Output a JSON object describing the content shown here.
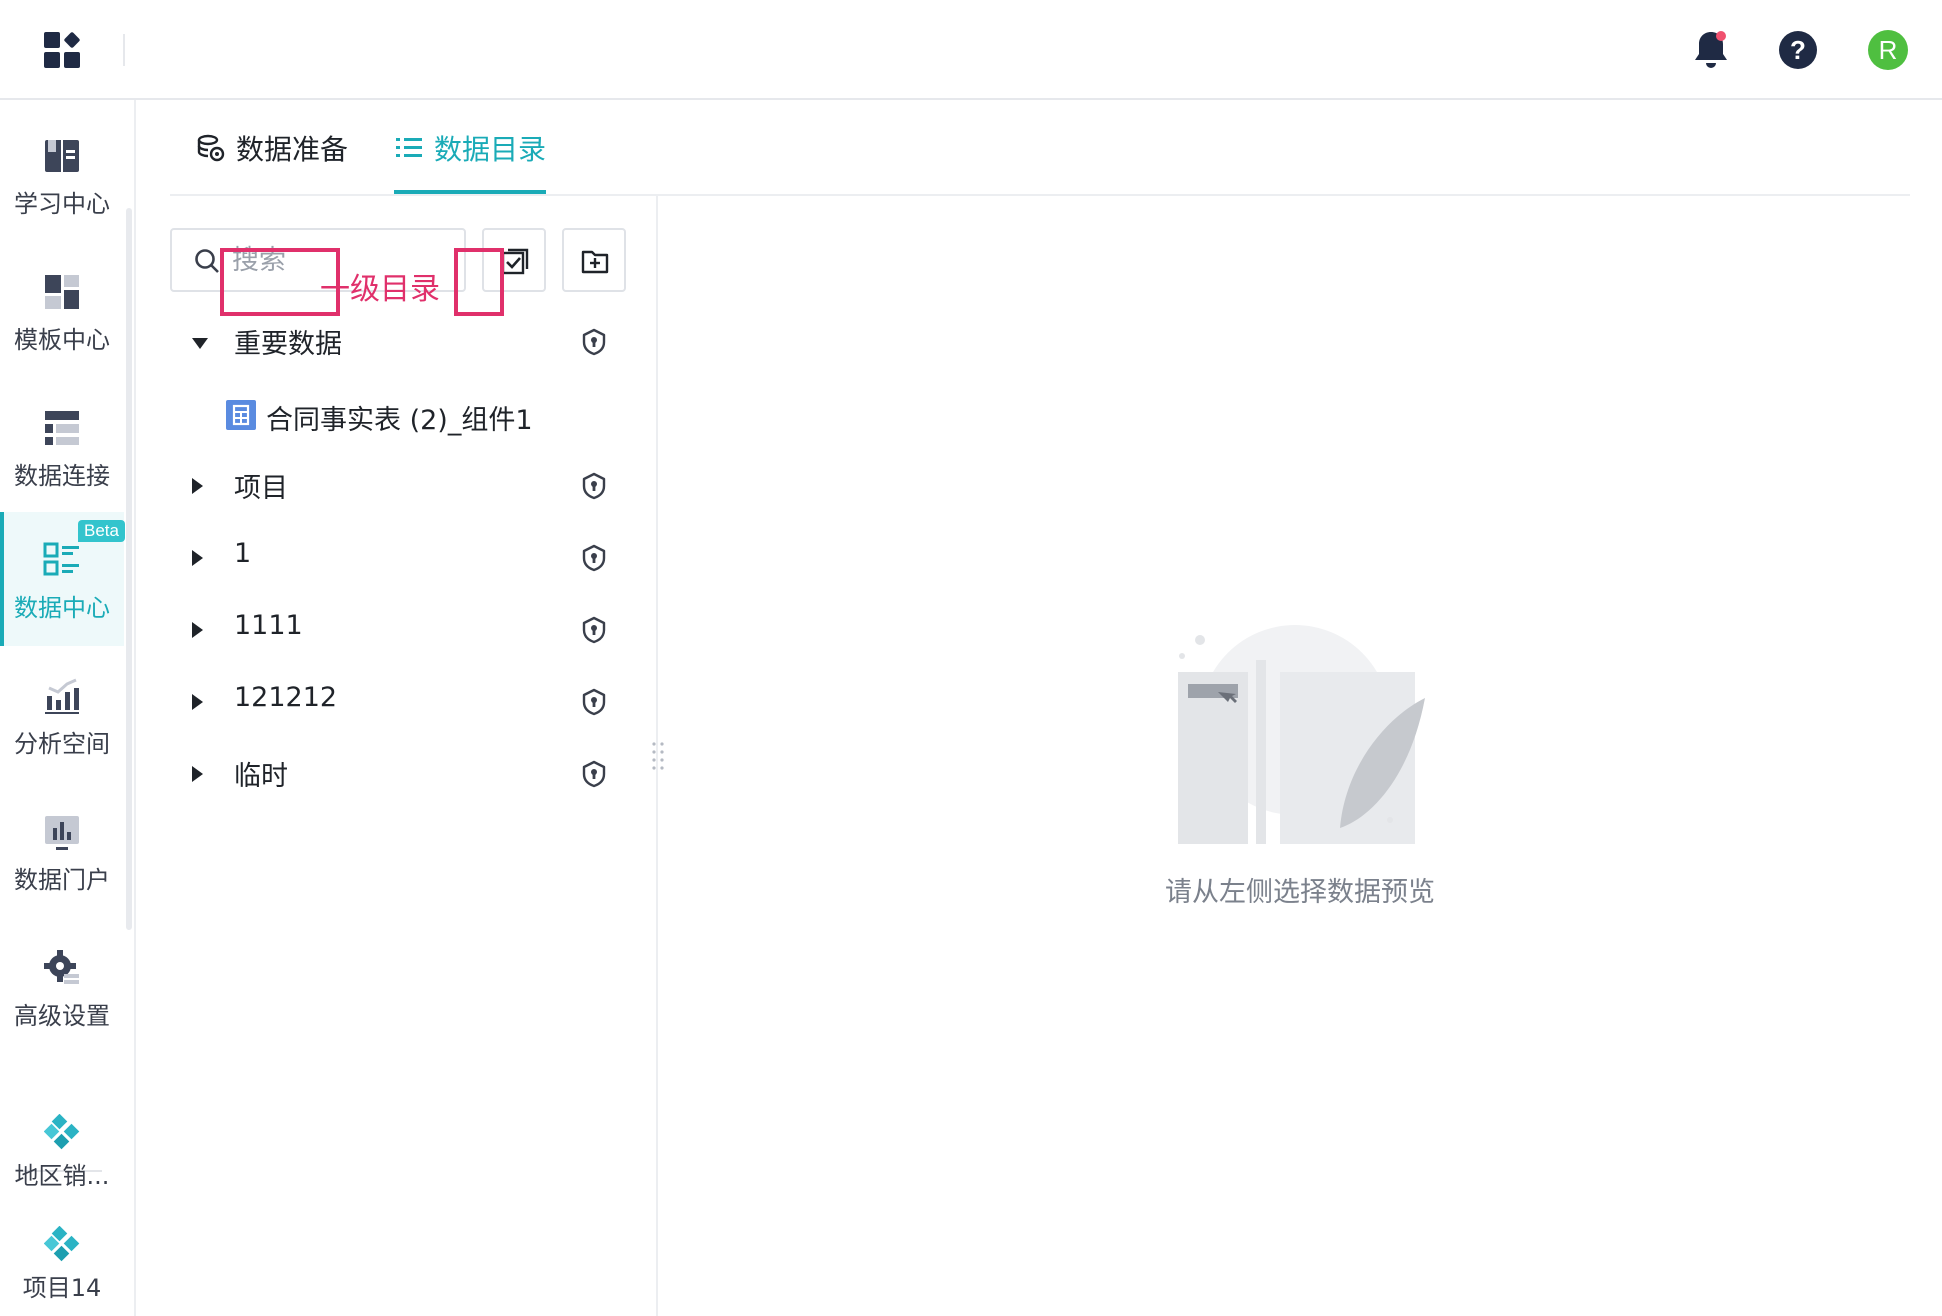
{
  "header": {
    "avatar_initial": "R",
    "accent_color": "#1aabb7"
  },
  "sidebar": {
    "items": [
      {
        "label": "学习中心",
        "icon": "book-icon"
      },
      {
        "label": "模板中心",
        "icon": "template-icon"
      },
      {
        "label": "数据连接",
        "icon": "connection-icon"
      },
      {
        "label": "数据中心",
        "icon": "data-center-icon",
        "badge": "Beta",
        "active": true
      },
      {
        "label": "分析空间",
        "icon": "analysis-icon"
      },
      {
        "label": "数据门户",
        "icon": "portal-icon"
      },
      {
        "label": "高级设置",
        "icon": "settings-icon"
      }
    ],
    "projects": [
      {
        "label": "地区销..."
      },
      {
        "label": "项目14"
      }
    ]
  },
  "tabs": [
    {
      "label": "数据准备",
      "icon": "data-prep-icon"
    },
    {
      "label": "数据目录",
      "icon": "list-icon",
      "active": true
    }
  ],
  "tree": {
    "search_placeholder": "搜索",
    "annotation": "一级目录",
    "annotation_color": "#e0306b",
    "rows": [
      {
        "name": "重要数据",
        "expanded": true
      },
      {
        "name": "合同事实表 (2)_组件1",
        "type": "table"
      },
      {
        "name": "项目"
      },
      {
        "name": "1"
      },
      {
        "name": "1111"
      },
      {
        "name": "121212"
      },
      {
        "name": "临时"
      }
    ]
  },
  "empty_state": {
    "message": "请从左侧选择数据预览"
  }
}
